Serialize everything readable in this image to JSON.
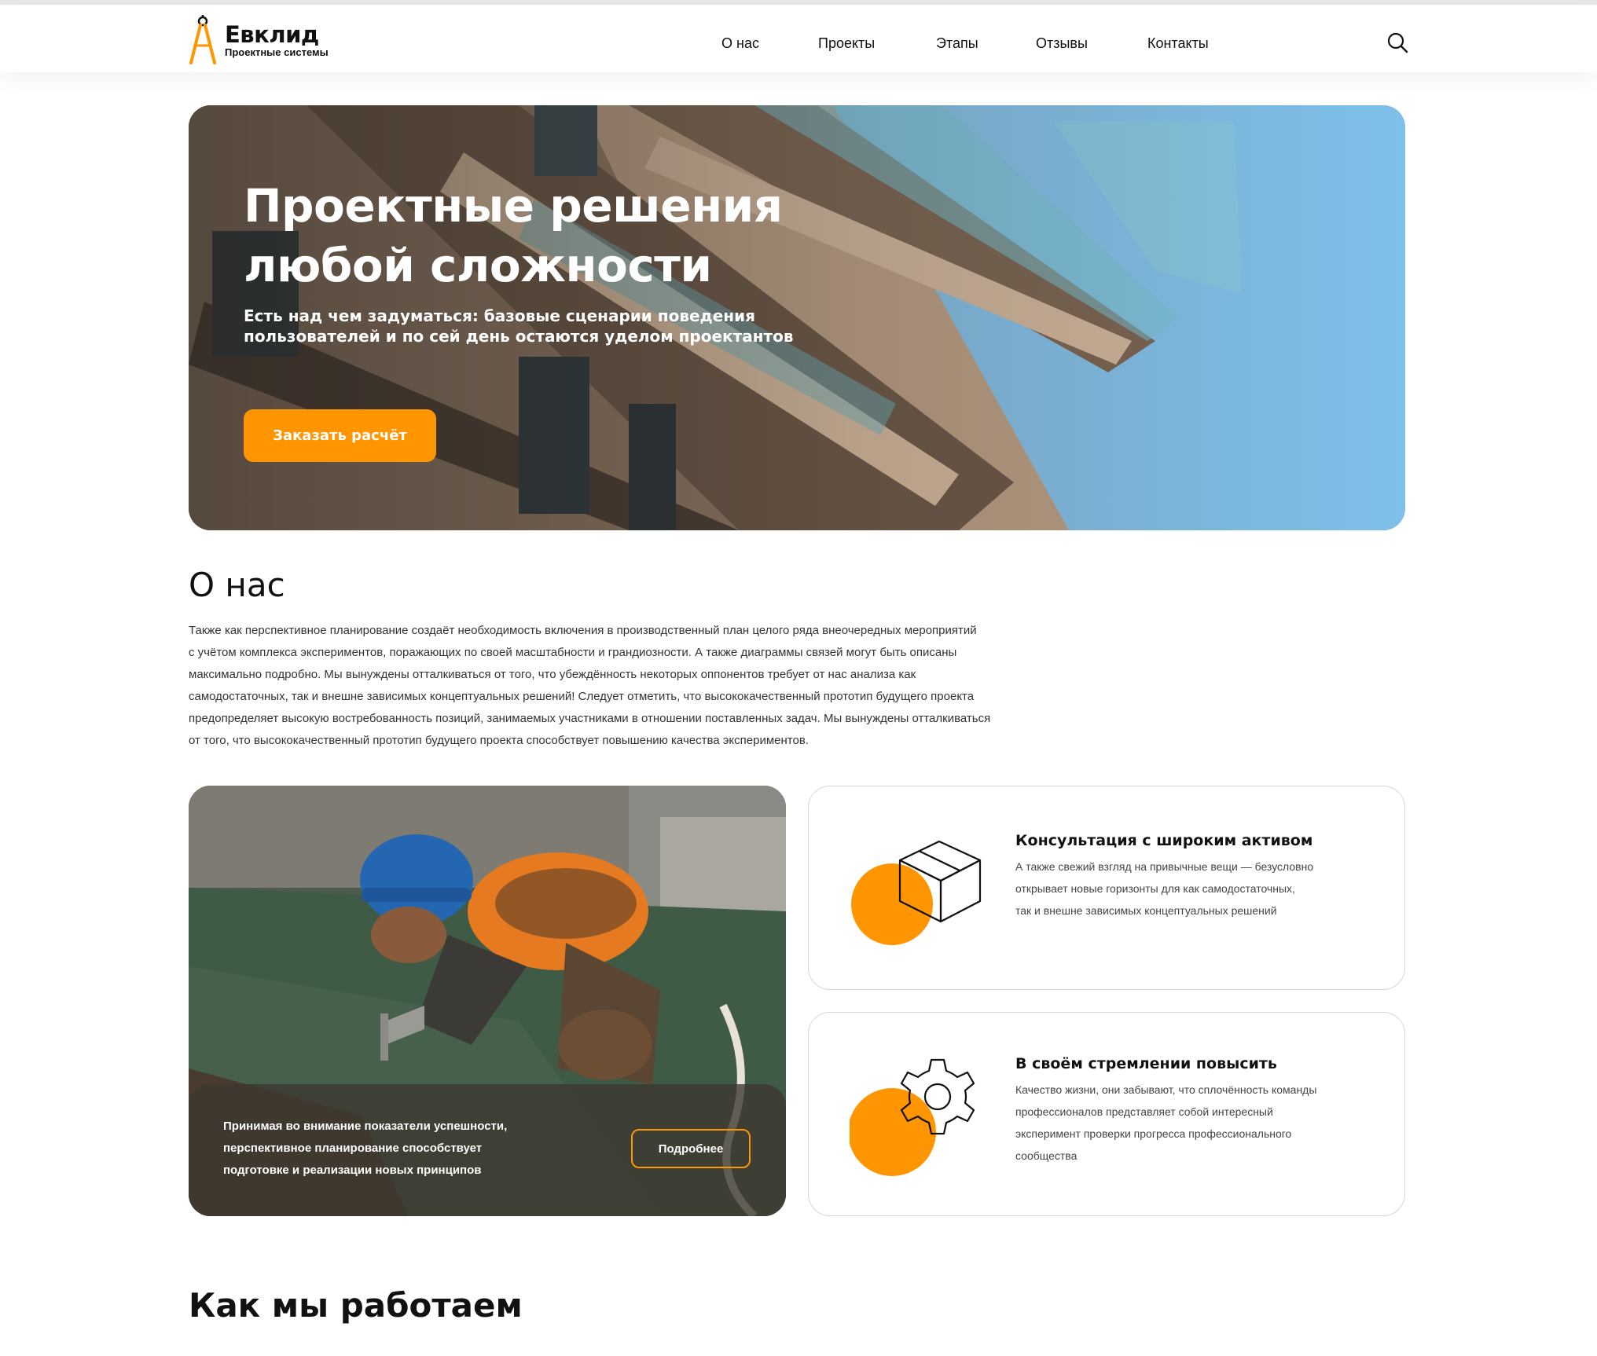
{
  "brand": {
    "name": "Евклид",
    "tagline": "Проектные системы",
    "accent": "#ff9500"
  },
  "nav": {
    "items": [
      "О нас",
      "Проекты",
      "Этапы",
      "Отзывы",
      "Контакты"
    ],
    "search_icon": "search-icon"
  },
  "hero": {
    "title_line1": "Проектные решения",
    "title_line2": "любой сложности",
    "subtitle_line1": "Есть над чем задуматься: базовые сценарии поведения",
    "subtitle_line2": "пользователей и по сей день остаются уделом проектантов",
    "cta_label": "Заказать расчёт"
  },
  "about": {
    "title": "О нас",
    "lines": [
      "Также как перспективное планирование создаёт необходимость включения в производственный план целого ряда внеочередных мероприятий",
      "с учётом комплекса экспериментов, поражающих по своей масштабности и грандиозности. А также диаграммы связей могут быть описаны",
      "максимально подробно. Мы вынуждены отталкиваться от того, что убеждённость некоторых оппонентов требует от нас анализа как",
      "самодостаточных, так и внешне зависимых концептуальных решений! Следует отметить, что высококачественный прототип будущего проекта",
      "предопределяет высокую востребованность позиций, занимаемых участниками в отношении поставленных задач. Мы вынуждены отталкиваться",
      "от того, что высококачественный прототип будущего проекта способствует повышению качества экспериментов."
    ]
  },
  "photo_card": {
    "lines": [
      "Принимая во внимание показатели успешности,",
      "перспективное планирование способствует",
      "подготовке и реализации новых принципов"
    ],
    "button_label": "Подробнее"
  },
  "features": [
    {
      "icon": "box-icon",
      "title": "Консультация с широким активом",
      "lines": [
        "А также свежий взгляд на привычные вещи — безусловно",
        "открывает новые горизонты для как самодостаточных,",
        "так и внешне зависимых концептуальных решений"
      ]
    },
    {
      "icon": "gear-icon",
      "title": "В своём стремлении повысить",
      "lines": [
        "Качество жизни, они забывают, что сплочённость команды",
        "профессионалов представляет собой интересный",
        "эксперимент проверки прогресса профессионального",
        "сообщества"
      ]
    }
  ],
  "how": {
    "title": "Как мы работаем"
  }
}
